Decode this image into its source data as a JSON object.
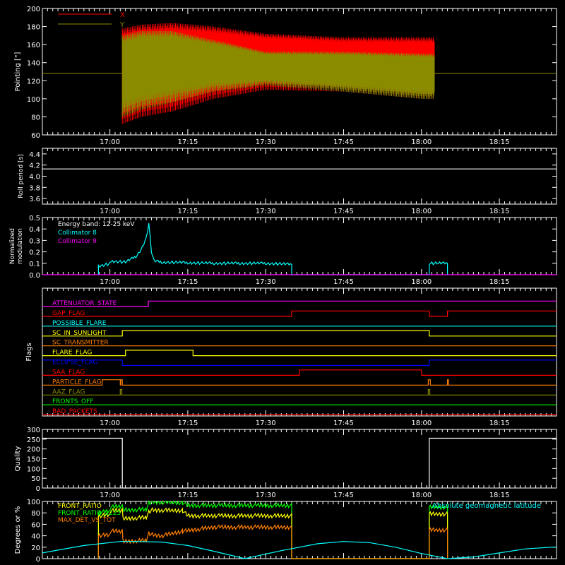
{
  "time_axis": {
    "tick_labels": [
      "17:00",
      "17:15",
      "17:30",
      "17:45",
      "18:00",
      "18:15"
    ],
    "tick_values_min": [
      0,
      15,
      30,
      45,
      60,
      75
    ],
    "range_min": [
      -13,
      86
    ]
  },
  "chart_data": [
    {
      "id": "pointing",
      "type": "line",
      "ylabel": "Pointing [\"]",
      "ylim": [
        60,
        200
      ],
      "yticks": [
        60,
        80,
        100,
        120,
        140,
        160,
        180,
        200
      ],
      "legend": [
        "X",
        "Y"
      ],
      "series": [
        {
          "name": "X",
          "color": "#ff0000",
          "baseline": 128,
          "envelope": [
            {
              "t": 2.4,
              "lo": 72,
              "hi": 178
            },
            {
              "t": 6,
              "lo": 80,
              "hi": 182
            },
            {
              "t": 12,
              "lo": 86,
              "hi": 184
            },
            {
              "t": 20,
              "lo": 100,
              "hi": 180
            },
            {
              "t": 30,
              "lo": 110,
              "hi": 172
            },
            {
              "t": 45,
              "lo": 108,
              "hi": 168
            },
            {
              "t": 60,
              "lo": 100,
              "hi": 168
            },
            {
              "t": 62.5,
              "lo": 100,
              "hi": 168
            }
          ]
        },
        {
          "name": "Y",
          "color": "#8b8b00",
          "baseline": 128,
          "envelope": [
            {
              "t": 2.4,
              "lo": 80,
              "hi": 170
            },
            {
              "t": 6,
              "lo": 88,
              "hi": 175
            },
            {
              "t": 12,
              "lo": 96,
              "hi": 175
            },
            {
              "t": 20,
              "lo": 108,
              "hi": 165
            },
            {
              "t": 30,
              "lo": 115,
              "hi": 152
            },
            {
              "t": 45,
              "lo": 108,
              "hi": 152
            },
            {
              "t": 60,
              "lo": 100,
              "hi": 150
            },
            {
              "t": 62.5,
              "lo": 100,
              "hi": 150
            }
          ]
        }
      ]
    },
    {
      "id": "roll",
      "type": "line",
      "ylabel": "Roll period [s]",
      "ylim": [
        3.5,
        4.5
      ],
      "yticks": [
        3.6,
        3.8,
        4.0,
        4.2,
        4.4
      ],
      "series": [
        {
          "name": "",
          "color": "#ffffff",
          "x": [
            -13,
            86
          ],
          "y": [
            4.13,
            4.13
          ]
        }
      ]
    },
    {
      "id": "modulation",
      "type": "line",
      "ylabel": "Normalized modulation",
      "ylim": [
        0,
        0.5
      ],
      "yticks": [
        0.0,
        0.1,
        0.2,
        0.3,
        0.4,
        0.5
      ],
      "legend": [
        "Energy band: 12-25 keV",
        "Collimator 8",
        "Collimator 9"
      ],
      "series": [
        {
          "name": "Collimator 8",
          "color": "#00ffff",
          "x": [
            -2.2,
            -2.2,
            0,
            3,
            5,
            6,
            7,
            7.5,
            8,
            8.5,
            10,
            20,
            30,
            35,
            35,
            61.5,
            61.5,
            65,
            65
          ],
          "y": [
            0,
            0.1,
            0.12,
            0.11,
            0.16,
            0.22,
            0.32,
            0.45,
            0.2,
            0.12,
            0.11,
            0.1,
            0.1,
            0.09,
            0,
            0,
            0.1,
            0.1,
            0
          ]
        },
        {
          "name": "Collimator 9",
          "color": "#ff00ff",
          "x": [
            -13,
            86
          ],
          "y": [
            0,
            0
          ]
        }
      ]
    },
    {
      "id": "flags",
      "type": "line",
      "ylabel": "Flags",
      "labels": [
        {
          "name": "ATTENUATOR_STATE",
          "color": "#ff00ff",
          "steps": [
            [
              -13,
              0
            ],
            [
              7.4,
              1
            ]
          ]
        },
        {
          "name": "GAP_FLAG",
          "color": "#ff0000",
          "steps": [
            [
              -13,
              0
            ],
            [
              35,
              1
            ],
            [
              61.5,
              0
            ],
            [
              65,
              1
            ]
          ]
        },
        {
          "name": "POSSIBLE_FLARE",
          "color": "#00ffff",
          "steps": [
            [
              -13,
              0
            ]
          ]
        },
        {
          "name": "SC_IN_SUNLIGHT",
          "color": "#ffff00",
          "steps": [
            [
              -13,
              0
            ],
            [
              2.4,
              1
            ],
            [
              61.5,
              0
            ]
          ]
        },
        {
          "name": "SC_TRANSMITTER",
          "color": "#ff7f00",
          "steps": [
            [
              -13,
              0
            ]
          ]
        },
        {
          "name": "FLARE_FLAG",
          "color": "#ffff00",
          "steps": [
            [
              -13,
              0
            ],
            [
              3,
              1
            ],
            [
              16,
              0
            ]
          ]
        },
        {
          "name": "ECLIPSE_FLAG",
          "color": "#0000ff",
          "steps": [
            [
              -13,
              1
            ],
            [
              2.4,
              0
            ],
            [
              61.5,
              1
            ]
          ]
        },
        {
          "name": "SAA_FLAG",
          "color": "#ff0000",
          "steps": [
            [
              -13,
              0
            ],
            [
              36.5,
              1
            ],
            [
              60,
              0
            ]
          ]
        },
        {
          "name": "PARTICLE_FLAG",
          "color": "#ff7f00",
          "steps": [
            [
              -13,
              0
            ],
            [
              -1.5,
              1
            ],
            [
              2.0,
              0
            ],
            [
              2.1,
              1
            ],
            [
              2.4,
              0
            ],
            [
              61.3,
              1
            ],
            [
              61.7,
              0
            ],
            [
              65,
              1
            ],
            [
              65.2,
              0
            ]
          ]
        },
        {
          "name": "AAZ_FLAG",
          "color": "#8b8b00",
          "steps": [
            [
              -13,
              0
            ],
            [
              2.0,
              1
            ],
            [
              2.3,
              0
            ],
            [
              61.3,
              1
            ],
            [
              61.6,
              0
            ]
          ]
        },
        {
          "name": "FRONTS_OFF",
          "color": "#00ff00",
          "steps": [
            [
              -13,
              0
            ]
          ]
        },
        {
          "name": "BAD_PACKETS",
          "color": "#ff0000",
          "steps": [
            [
              -13,
              0
            ]
          ]
        }
      ]
    },
    {
      "id": "quality",
      "type": "line",
      "ylabel": "Quality",
      "ylim": [
        0,
        300
      ],
      "yticks": [
        0,
        50,
        100,
        150,
        200,
        250,
        300
      ],
      "series": [
        {
          "name": "",
          "color": "#ffffff",
          "x": [
            -13,
            2.4,
            2.4,
            61.5,
            61.5,
            86
          ],
          "y": [
            255,
            255,
            0,
            0,
            255,
            255
          ]
        }
      ]
    },
    {
      "id": "ratios",
      "type": "line",
      "ylabel": "Degrees or %",
      "ylim": [
        0,
        100
      ],
      "yticks": [
        0,
        20,
        40,
        60,
        80,
        100
      ],
      "legend_left": [
        "FRONT_RATIO",
        "FRONT_RATIO_1225",
        "MAX_DET_VS_TOT"
      ],
      "legend_right": "Absolute geomagnetic latitude",
      "series": [
        {
          "name": "FRONT_RATIO_1225",
          "color": "#00ff00",
          "x": [
            -2.2,
            -2.2,
            2.4,
            2.5,
            7,
            7.5,
            8,
            14,
            15,
            35,
            35,
            61.5,
            61.5,
            65,
            65
          ],
          "y": [
            0,
            88,
            92,
            85,
            86,
            98,
            99,
            98,
            93,
            93,
            0,
            0,
            90,
            90,
            0
          ]
        },
        {
          "name": "FRONT_RATIO",
          "color": "#ffff00",
          "x": [
            -2.2,
            -2.2,
            2.4,
            2.5,
            7,
            7.5,
            8,
            14,
            15,
            35,
            35,
            61.5,
            61.5,
            65,
            65
          ],
          "y": [
            0,
            82,
            85,
            70,
            72,
            82,
            85,
            84,
            75,
            75,
            0,
            0,
            78,
            78,
            0
          ]
        },
        {
          "name": "MAX_DET_VS_TOT",
          "color": "#ff7f00",
          "x": [
            -2.2,
            -2.2,
            2.4,
            2.5,
            7,
            7.5,
            8,
            10,
            14,
            20,
            35,
            35,
            61.5,
            61.5,
            65,
            65
          ],
          "y": [
            0,
            48,
            48,
            30,
            32,
            45,
            42,
            40,
            48,
            55,
            55,
            0,
            0,
            50,
            50,
            0
          ]
        },
        {
          "name": "Absolute geomagnetic latitude",
          "color": "#00ffff",
          "x": [
            -13,
            -10,
            -5,
            0,
            2,
            5,
            10,
            15,
            20,
            26,
            33,
            40,
            45,
            50,
            55,
            60,
            65,
            70,
            75,
            80,
            85,
            86
          ],
          "y": [
            10,
            15,
            23,
            28,
            30,
            30,
            29,
            23,
            13,
            0,
            14,
            26,
            30,
            28,
            20,
            9,
            0,
            3,
            10,
            17,
            20,
            20
          ]
        }
      ]
    }
  ]
}
